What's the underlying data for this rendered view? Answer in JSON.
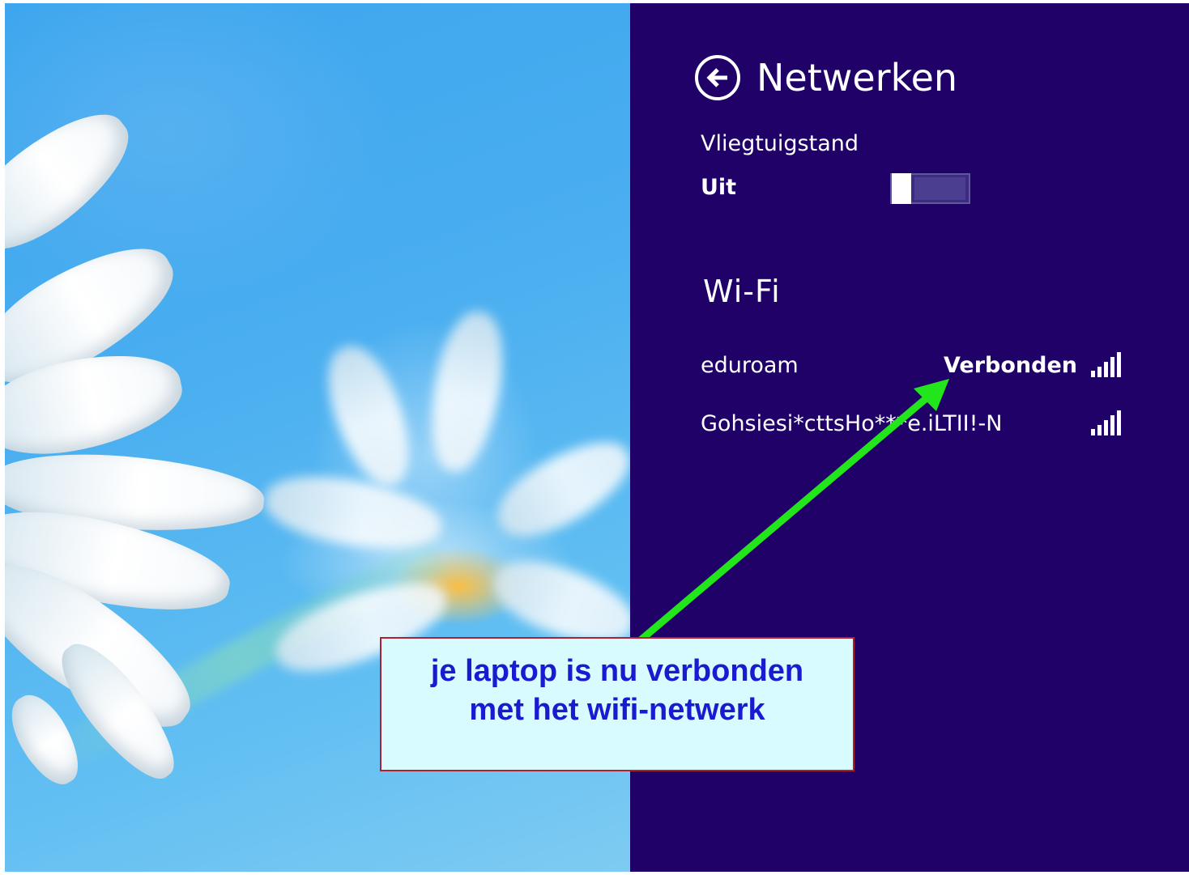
{
  "panel": {
    "title": "Netwerken",
    "back_icon": "arrow-left-circle-icon",
    "airplane_mode": {
      "label": "Vliegtuigstand",
      "state": "Uit",
      "on": false
    },
    "wifi_section": "Wi-Fi",
    "networks": [
      {
        "name": "eduroam",
        "status": "Verbonden",
        "signal_bars": 5
      },
      {
        "name": "Gohsiesi*cttsHo***e.iLTII!-N",
        "status": "",
        "signal_bars": 5
      }
    ]
  },
  "annotation": {
    "line1": "je laptop is nu verbonden",
    "line2": "met het wifi-netwerk",
    "arrow_color": "#22e51c"
  },
  "colors": {
    "panel_bg": "#1f0168",
    "callout_bg": "#d8fbff",
    "callout_text": "#1a1ad0",
    "callout_border": "#b0202e"
  }
}
